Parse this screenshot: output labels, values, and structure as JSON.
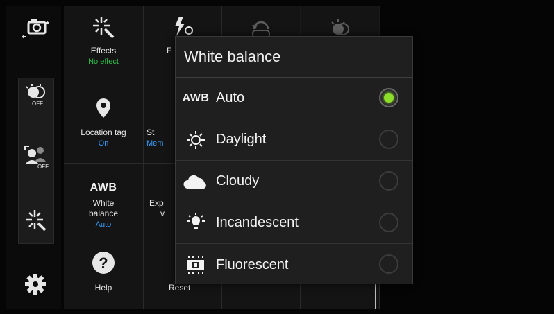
{
  "camera_menu": {
    "effects": {
      "label": "Effects",
      "value": "No effect"
    },
    "flash_label_partial": "F",
    "location_tag": {
      "label": "Location tag",
      "value": "On"
    },
    "storage_label_partial": "St",
    "storage_value_partial": "Mem",
    "white_balance": {
      "icon_text": "AWB",
      "label_line1": "White",
      "label_line2": "balance",
      "value": "Auto"
    },
    "exposure_label_partial_1": "Exp",
    "exposure_label_partial_2": "v",
    "help": {
      "label": "Help"
    },
    "reset": {
      "label": "Reset"
    }
  },
  "dialog": {
    "title": "White balance",
    "options": [
      {
        "label": "Auto",
        "icon": "awb-icon",
        "icon_text": "AWB",
        "selected": true
      },
      {
        "label": "Daylight",
        "icon": "sun-icon",
        "selected": false
      },
      {
        "label": "Cloudy",
        "icon": "cloud-icon",
        "selected": false
      },
      {
        "label": "Incandescent",
        "icon": "bulb-icon",
        "selected": false
      },
      {
        "label": "Fluorescent",
        "icon": "fluorescent-icon",
        "selected": false
      }
    ]
  },
  "colors": {
    "accent_value": "#3aa0ff",
    "selected_radio": "#8dde2a"
  }
}
